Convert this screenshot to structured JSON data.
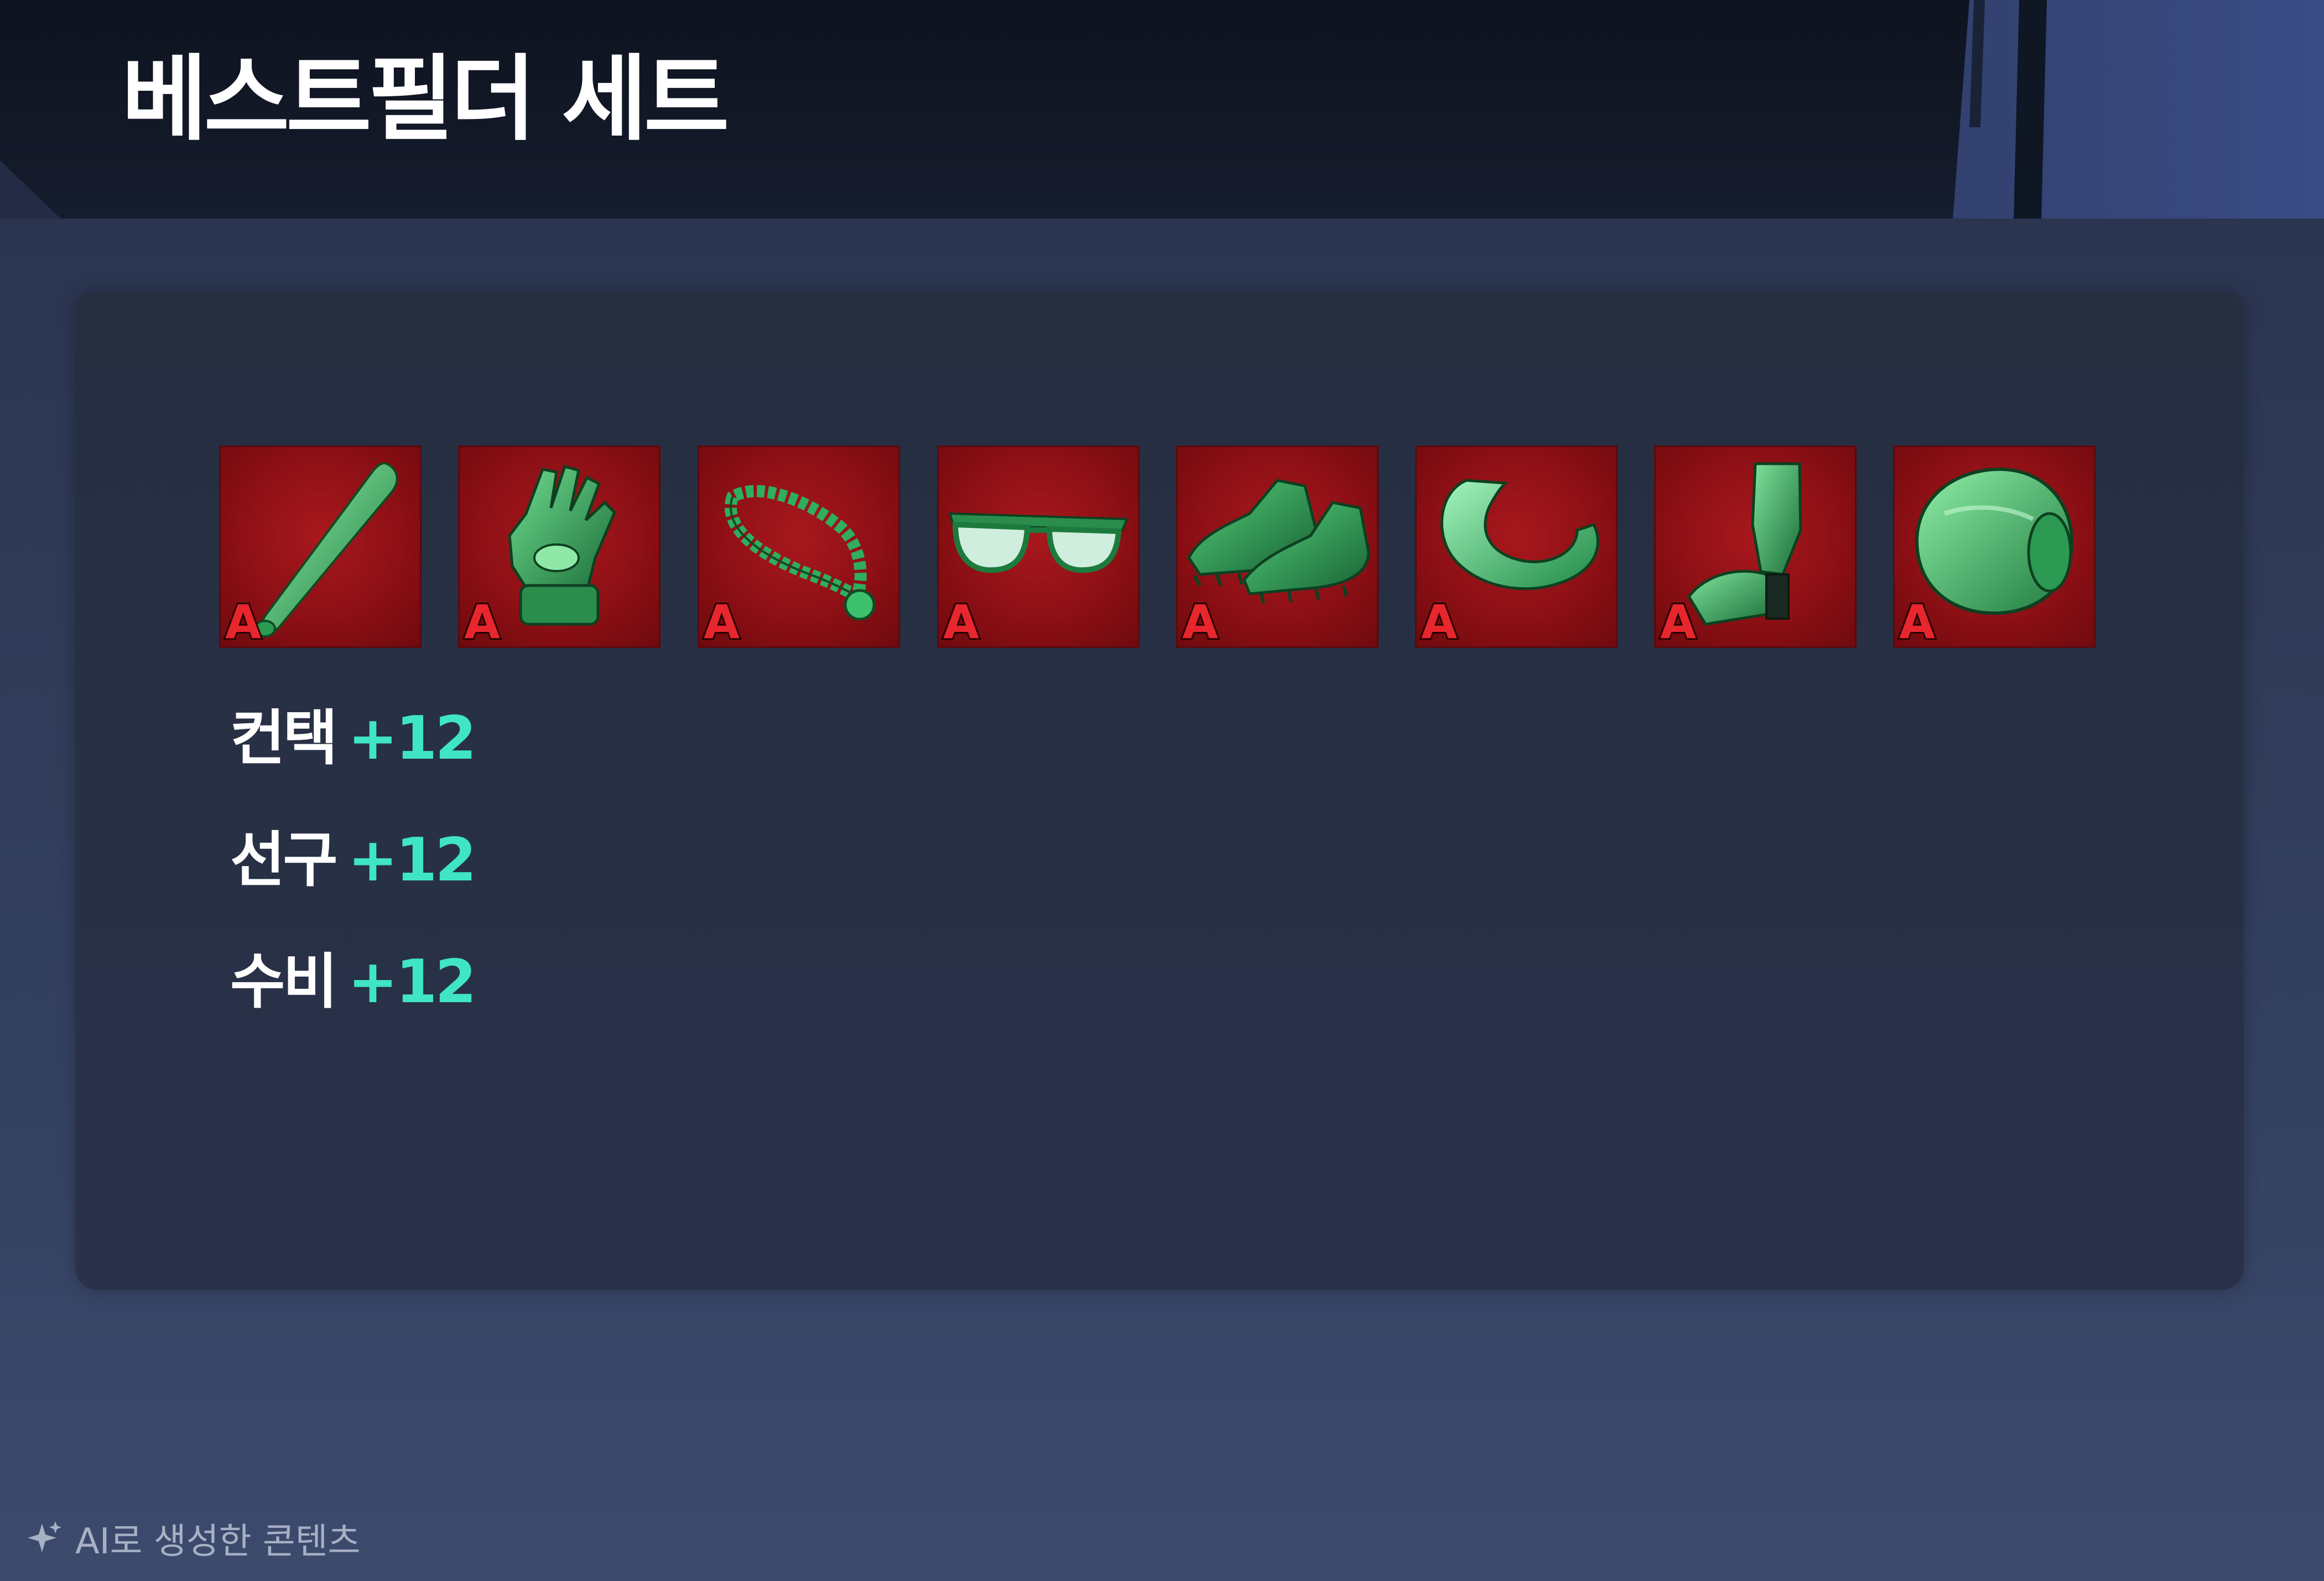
{
  "title": "베스트필더 세트",
  "equipment": [
    {
      "icon": "bat-icon",
      "grade": "A"
    },
    {
      "icon": "batting-glove-icon",
      "grade": "A"
    },
    {
      "icon": "necklace-icon",
      "grade": "A"
    },
    {
      "icon": "sunglasses-icon",
      "grade": "A"
    },
    {
      "icon": "cleats-icon",
      "grade": "A"
    },
    {
      "icon": "mouthguard-icon",
      "grade": "A"
    },
    {
      "icon": "leg-guard-icon",
      "grade": "A"
    },
    {
      "icon": "wristband-icon",
      "grade": "A"
    }
  ],
  "stats": [
    {
      "name": "컨택",
      "value": "+12"
    },
    {
      "name": "선구",
      "value": "+12"
    },
    {
      "name": "수비",
      "value": "+12"
    }
  ],
  "footer": {
    "icon": "sparkle-icon",
    "label": "AI로 생성한 콘텐츠"
  },
  "colors": {
    "accent": "#3fe5c4",
    "slot_background": "#8a0f14",
    "grade_text": "#e8262d",
    "item_green": "#2fae5f"
  }
}
